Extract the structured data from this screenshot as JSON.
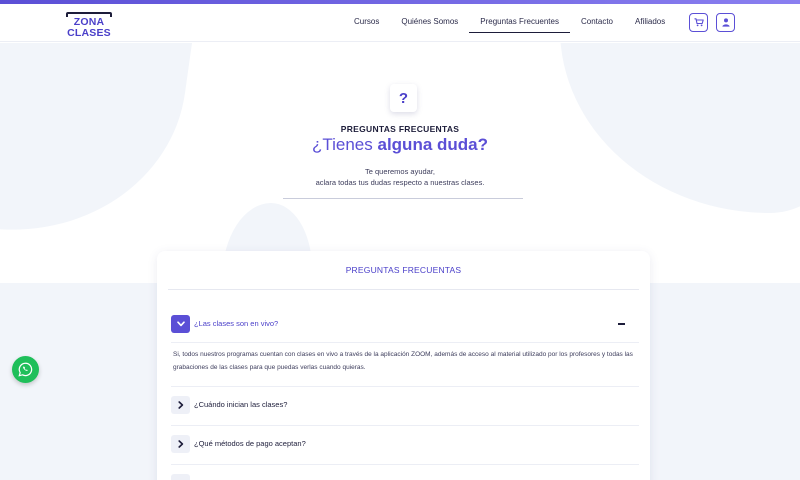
{
  "brand": {
    "name": "ZONA CLASES",
    "accent": "#5b4fd6"
  },
  "nav": {
    "items": [
      {
        "label": "Cursos"
      },
      {
        "label": "Quiénes Somos"
      },
      {
        "label": "Preguntas Frecuentes",
        "active": true
      },
      {
        "label": "Contacto"
      },
      {
        "label": "Afiliados"
      }
    ],
    "cart_icon": "cart-icon",
    "user_icon": "user-icon"
  },
  "hero": {
    "badge": "?",
    "eyebrow": "PREGUNTAS FRECUENTAS",
    "title_prefix": "¿Tienes ",
    "title_bold": "alguna duda?",
    "subtitle_line1": "Te queremos ayudar,",
    "subtitle_line2": "aclara todas tus dudas respecto a nuestras clases."
  },
  "faq": {
    "title": "PREGUNTAS FRECUENTAS",
    "items": [
      {
        "question": "¿Las clases son en vivo?",
        "open": true,
        "answer": "Si, todos nuestros programas cuentan con clases en vivo a través de la aplicación ZOOM, además de acceso al material utilizado por los profesores y todas las grabaciones de las clases para que puedas verlas cuando quieras."
      },
      {
        "question": "¿Cuándo inician las clases?",
        "open": false
      },
      {
        "question": "¿Qué métodos de pago aceptan?",
        "open": false
      }
    ]
  },
  "floating": {
    "whatsapp_icon": "whatsapp-icon",
    "whatsapp_color": "#1fbf5a"
  }
}
